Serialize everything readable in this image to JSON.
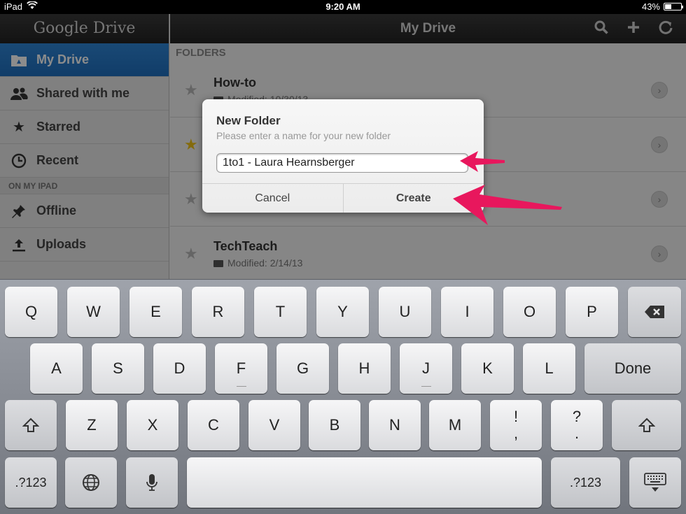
{
  "status_bar": {
    "carrier": "iPad",
    "time": "9:20 AM",
    "battery": "43%",
    "battery_level": 0.43
  },
  "sidebar": {
    "logo": "Google Drive",
    "items": [
      {
        "label": "My Drive",
        "icon": "drive-folder-icon",
        "active": true
      },
      {
        "label": "Shared with me",
        "icon": "people-icon"
      },
      {
        "label": "Starred",
        "icon": "star-icon"
      },
      {
        "label": "Recent",
        "icon": "clock-icon"
      }
    ],
    "section_label": "ON MY IPAD",
    "device_items": [
      {
        "label": "Offline",
        "icon": "pin-icon"
      },
      {
        "label": "Uploads",
        "icon": "upload-icon"
      }
    ]
  },
  "main": {
    "title": "My Drive",
    "header_icons": [
      "search-icon",
      "plus-icon",
      "refresh-icon"
    ],
    "section_label": "FOLDERS",
    "folders": [
      {
        "name": "How-to",
        "modified": "Modified: 10/30/13",
        "starred": false
      },
      {
        "name": "",
        "modified": "",
        "starred": true
      },
      {
        "name": "",
        "modified": "",
        "starred": false
      },
      {
        "name": "TechTeach",
        "modified": "Modified: 2/14/13",
        "starred": false
      }
    ]
  },
  "dialog": {
    "title": "New Folder",
    "subtitle": "Please enter a name for your new folder",
    "input_value": "1to1 - Laura Hearnsberger",
    "cancel_label": "Cancel",
    "create_label": "Create"
  },
  "annotation_color": "#e8175d",
  "keyboard": {
    "row1": [
      "Q",
      "W",
      "E",
      "R",
      "T",
      "Y",
      "U",
      "I",
      "O",
      "P"
    ],
    "row2": [
      "A",
      "S",
      "D",
      "F",
      "G",
      "H",
      "J",
      "K",
      "L"
    ],
    "row3": [
      "Z",
      "X",
      "C",
      "V",
      "B",
      "N",
      "M"
    ],
    "done_label": "Done",
    "excl_top": "!",
    "excl_bottom": ",",
    "question_top": "?",
    "question_bottom": ".",
    "numbers_label": ".?123",
    "backspace_icon": "backspace-icon",
    "shift_icon": "shift-icon",
    "globe_icon": "globe-icon",
    "mic_icon": "microphone-icon",
    "dismiss_icon": "keyboard-dismiss-icon"
  }
}
